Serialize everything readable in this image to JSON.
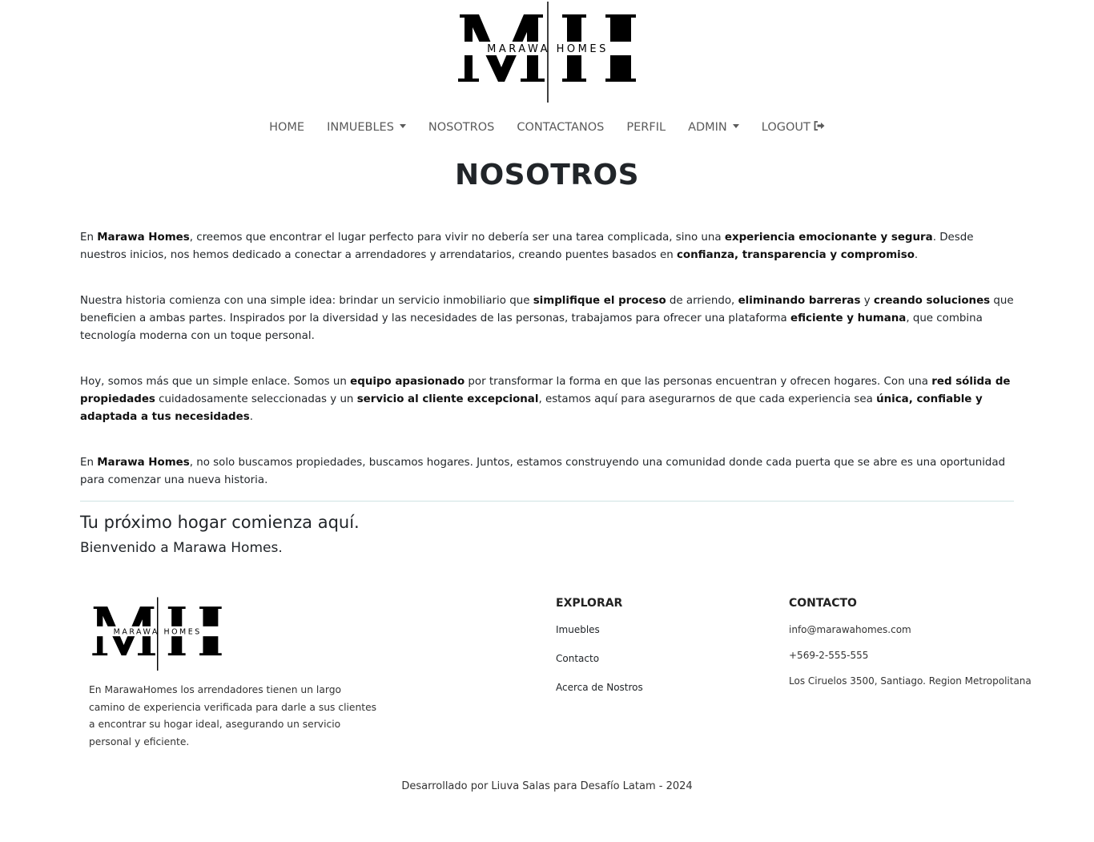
{
  "brand": {
    "name": "MARAWA HOMES",
    "monogram": "MH"
  },
  "nav": {
    "items": [
      {
        "label": "HOME"
      },
      {
        "label": "INMUEBLES"
      },
      {
        "label": "NOSOTROS"
      },
      {
        "label": "CONTACTANOS"
      },
      {
        "label": "PERFIL"
      },
      {
        "label": "ADMIN"
      },
      {
        "label": "LOGOUT"
      }
    ]
  },
  "page": {
    "title": "NOSOTROS"
  },
  "about": {
    "p1": [
      {
        "text": "En ",
        "bold": false
      },
      {
        "text": "Marawa Homes",
        "bold": true
      },
      {
        "text": ", creemos que encontrar el lugar perfecto para vivir no debería ser una tarea complicada, sino una ",
        "bold": false
      },
      {
        "text": "experiencia emocionante y segura",
        "bold": true
      },
      {
        "text": ". Desde nuestros inicios, nos hemos dedicado a conectar a arrendadores y arrendatarios, creando puentes basados en ",
        "bold": false
      },
      {
        "text": "confianza, transparencia y compromiso",
        "bold": true
      },
      {
        "text": ".",
        "bold": false
      }
    ],
    "p2": [
      {
        "text": "Nuestra historia comienza con una simple idea: brindar un servicio inmobiliario que ",
        "bold": false
      },
      {
        "text": "simplifique el proceso",
        "bold": true
      },
      {
        "text": " de arriendo, ",
        "bold": false
      },
      {
        "text": "eliminando barreras",
        "bold": true
      },
      {
        "text": " y ",
        "bold": false
      },
      {
        "text": "creando soluciones",
        "bold": true
      },
      {
        "text": " que beneficien a ambas partes. Inspirados por la diversidad y las necesidades de las personas, trabajamos para ofrecer una plataforma ",
        "bold": false
      },
      {
        "text": "eficiente y humana",
        "bold": true
      },
      {
        "text": ", que combina tecnología moderna con un toque personal.",
        "bold": false
      }
    ],
    "p3": [
      {
        "text": "Hoy, somos más que un simple enlace. Somos un ",
        "bold": false
      },
      {
        "text": "equipo apasionado",
        "bold": true
      },
      {
        "text": " por transformar la forma en que las personas encuentran y ofrecen hogares. Con una ",
        "bold": false
      },
      {
        "text": "red sólida de propiedades",
        "bold": true
      },
      {
        "text": " cuidadosamente seleccionadas y un ",
        "bold": false
      },
      {
        "text": "servicio al cliente excepcional",
        "bold": true
      },
      {
        "text": ", estamos aquí para asegurarnos de que cada experiencia sea ",
        "bold": false
      },
      {
        "text": "única, confiable y adaptada a tus necesidades",
        "bold": true
      },
      {
        "text": ".",
        "bold": false
      }
    ],
    "p4": [
      {
        "text": "En ",
        "bold": false
      },
      {
        "text": "Marawa Homes",
        "bold": true
      },
      {
        "text": ", no solo buscamos propiedades, buscamos hogares. Juntos, estamos construyendo una comunidad donde cada puerta que se abre es una oportunidad para comenzar una nueva historia.",
        "bold": false
      }
    ]
  },
  "banner": {
    "tagline": "Tu próximo hogar comienza aquí.",
    "welcome": "Bienvenido a Marawa Homes."
  },
  "footer": {
    "about": "En MarawaHomes los arrendadores tienen un largo camino de experiencia verificada para darle a sus clientes a encontrar su hogar ideal, asegurando un servicio personal y eficiente.",
    "explorar": {
      "title": "EXPLORAR",
      "links": [
        "Imuebles",
        "Contacto",
        "Acerca de Nostros"
      ]
    },
    "contacto": {
      "title": "CONTACTO",
      "email": "info@marawahomes.com",
      "phone": "+569-2-555-555",
      "address": "Los Ciruelos 3500, Santiago. Region Metropolitana"
    },
    "credits": "Desarrollado por Liuva Salas para Desafío Latam - 2024"
  },
  "icons": {
    "logout": "sign-out-icon",
    "dropdown": "caret-down-icon"
  }
}
